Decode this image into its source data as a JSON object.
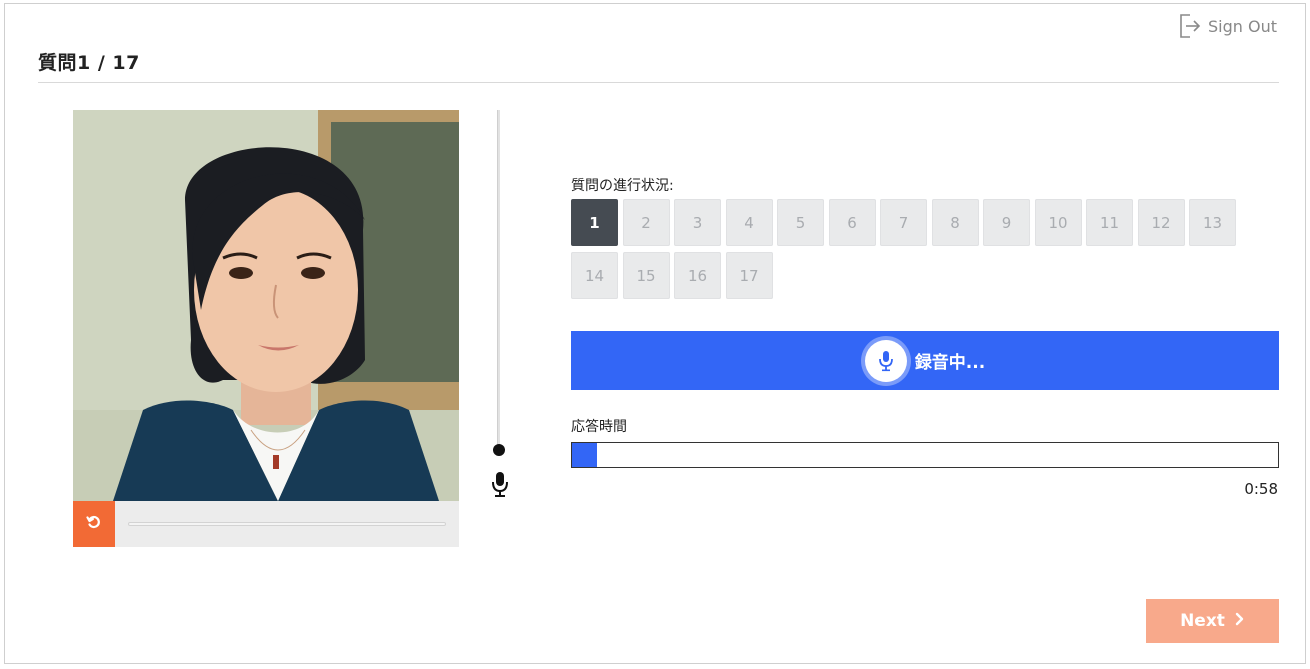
{
  "header": {
    "sign_out_label": "Sign Out",
    "sign_out_icon": "sign-out-icon",
    "question_title": "質問1 / 17"
  },
  "video": {
    "replay_icon": "replay-icon",
    "accent_color": "#f26a35"
  },
  "progress": {
    "label": "質問の進行状況:",
    "questions": [
      "1",
      "2",
      "3",
      "4",
      "5",
      "6",
      "7",
      "8",
      "9",
      "10",
      "11",
      "12",
      "13",
      "14",
      "15",
      "16",
      "17"
    ],
    "current": "1"
  },
  "recording": {
    "label": "録音中...",
    "icon": "microphone-icon",
    "color": "#3366f6"
  },
  "answer_time": {
    "label": "応答時間",
    "remaining": "0:58",
    "elapsed_fraction": 0.035
  },
  "footer": {
    "next_label": "Next",
    "next_icon": "chevron-right-icon",
    "next_color": "#f8a98b"
  }
}
